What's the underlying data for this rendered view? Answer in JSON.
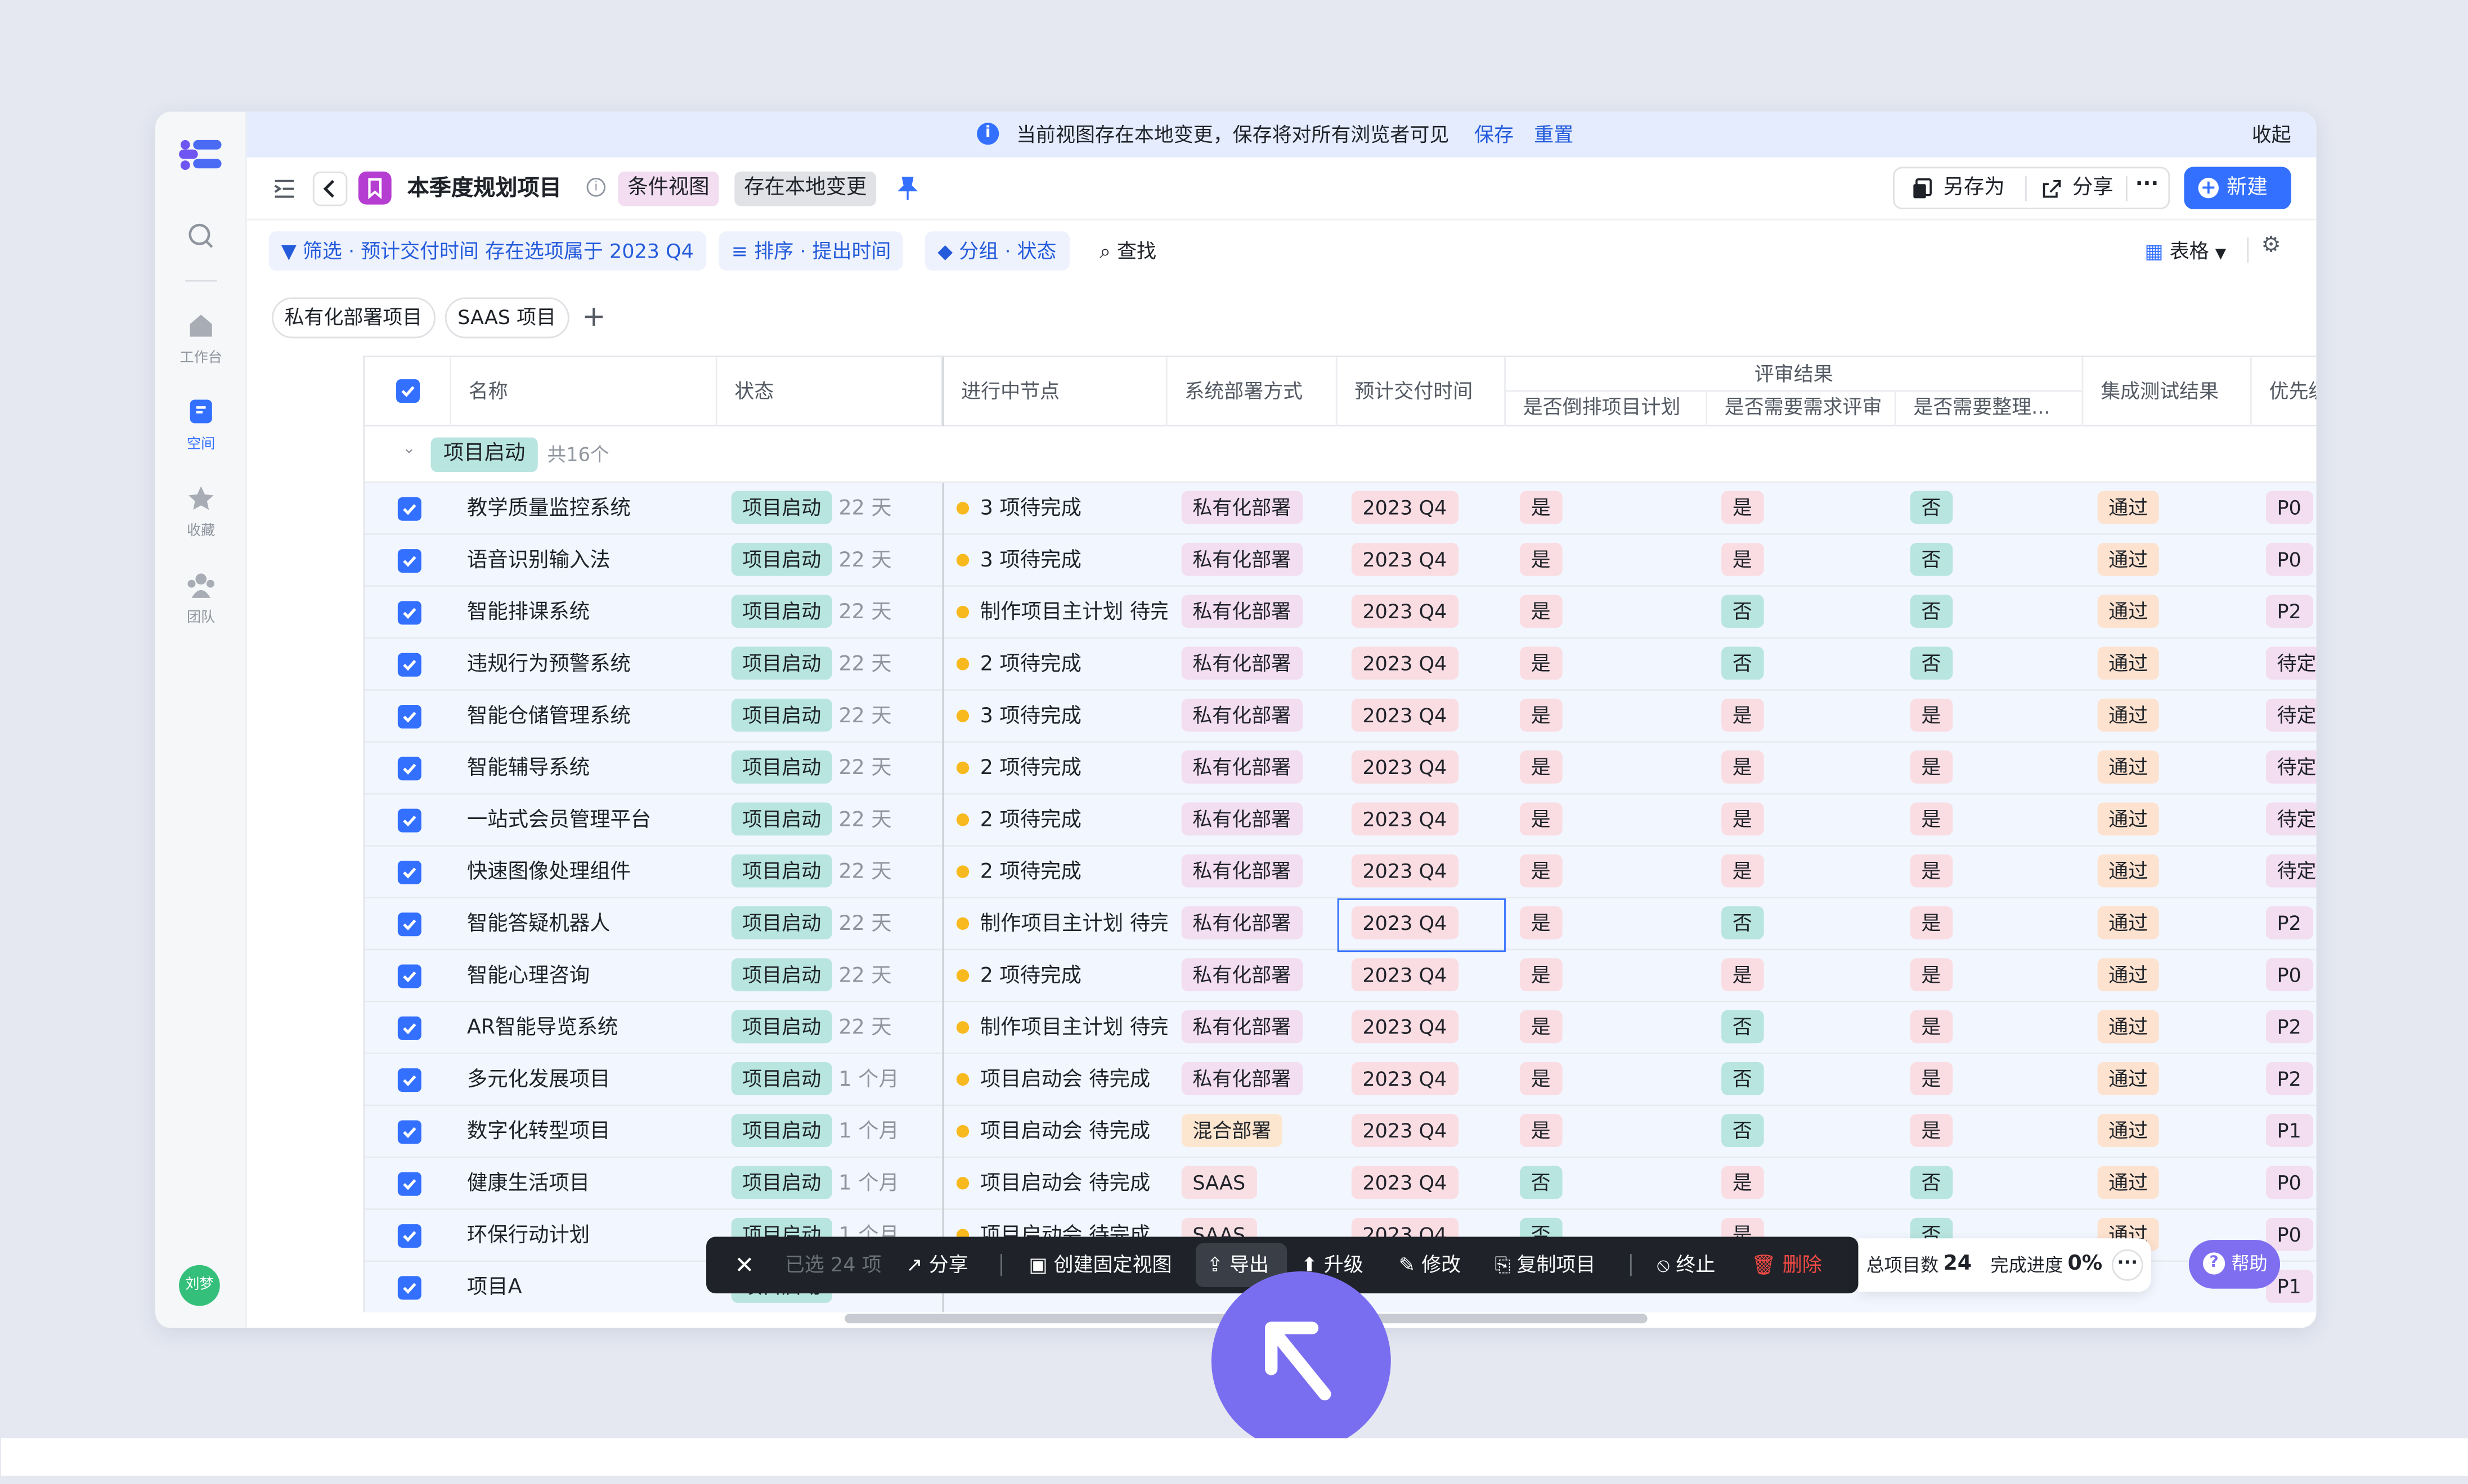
{
  "user": {
    "avatar_label": "刘梦"
  },
  "sidebar": {
    "items": [
      {
        "label": ""
      },
      {
        "label": "工作台"
      },
      {
        "label": "空间"
      },
      {
        "label": "收藏"
      },
      {
        "label": "团队"
      }
    ]
  },
  "banner": {
    "message": "当前视图存在本地变更，保存将对所有浏览者可见",
    "save": "保存",
    "reset": "重置",
    "collapse": "收起"
  },
  "header": {
    "title": "本季度规划项目",
    "view_type": "条件视图",
    "local_changes": "存在本地变更",
    "save_as": "另存为",
    "share": "分享",
    "new": "新建"
  },
  "filters": {
    "filter": "筛选 · 预计交付时间 存在选项属于 2023 Q4",
    "sort": "排序 · 提出时间",
    "group": "分组 · 状态",
    "search": "查找",
    "view_mode": "表格"
  },
  "tabs": [
    "私有化部署项目",
    "SAAS 项目"
  ],
  "columns": {
    "name": "名称",
    "status": "状态",
    "node": "进行中节点",
    "deploy": "系统部署方式",
    "delivery": "预计交付时间",
    "review_group": "评审结果",
    "review_1": "是否倒排项目计划",
    "review_2": "是否需要需求评审",
    "review_3": "是否需要整理...",
    "test": "集成测试结果",
    "priority": "优先级"
  },
  "group": {
    "label": "项目启动",
    "count": "共16个"
  },
  "rows": [
    {
      "name": "教学质量监控系统",
      "status": "项目启动",
      "duration": "22 天",
      "node": "3 项待完成",
      "deploy": "私有化部署",
      "delivery": "2023 Q4",
      "r1": "是",
      "r2": "是",
      "r3": "否",
      "test": "通过",
      "priority": "P0"
    },
    {
      "name": "语音识别输入法",
      "status": "项目启动",
      "duration": "22 天",
      "node": "3 项待完成",
      "deploy": "私有化部署",
      "delivery": "2023 Q4",
      "r1": "是",
      "r2": "是",
      "r3": "否",
      "test": "通过",
      "priority": "P0"
    },
    {
      "name": "智能排课系统",
      "status": "项目启动",
      "duration": "22 天",
      "node": "制作项目主计划 待完",
      "deploy": "私有化部署",
      "delivery": "2023 Q4",
      "r1": "是",
      "r2": "否",
      "r3": "否",
      "test": "通过",
      "priority": "P2"
    },
    {
      "name": "违规行为预警系统",
      "status": "项目启动",
      "duration": "22 天",
      "node": "2 项待完成",
      "deploy": "私有化部署",
      "delivery": "2023 Q4",
      "r1": "是",
      "r2": "否",
      "r3": "否",
      "test": "通过",
      "priority": "待定"
    },
    {
      "name": "智能仓储管理系统",
      "status": "项目启动",
      "duration": "22 天",
      "node": "3 项待完成",
      "deploy": "私有化部署",
      "delivery": "2023 Q4",
      "r1": "是",
      "r2": "是",
      "r3": "是",
      "test": "通过",
      "priority": "待定"
    },
    {
      "name": "智能辅导系统",
      "status": "项目启动",
      "duration": "22 天",
      "node": "2 项待完成",
      "deploy": "私有化部署",
      "delivery": "2023 Q4",
      "r1": "是",
      "r2": "是",
      "r3": "是",
      "test": "通过",
      "priority": "待定"
    },
    {
      "name": "一站式会员管理平台",
      "status": "项目启动",
      "duration": "22 天",
      "node": "2 项待完成",
      "deploy": "私有化部署",
      "delivery": "2023 Q4",
      "r1": "是",
      "r2": "是",
      "r3": "是",
      "test": "通过",
      "priority": "待定"
    },
    {
      "name": "快速图像处理组件",
      "status": "项目启动",
      "duration": "22 天",
      "node": "2 项待完成",
      "deploy": "私有化部署",
      "delivery": "2023 Q4",
      "r1": "是",
      "r2": "是",
      "r3": "是",
      "test": "通过",
      "priority": "待定"
    },
    {
      "name": "智能答疑机器人",
      "status": "项目启动",
      "duration": "22 天",
      "node": "制作项目主计划 待完",
      "deploy": "私有化部署",
      "delivery": "2023 Q4",
      "r1": "是",
      "r2": "否",
      "r3": "是",
      "test": "通过",
      "priority": "P2"
    },
    {
      "name": "智能心理咨询",
      "status": "项目启动",
      "duration": "22 天",
      "node": "2 项待完成",
      "deploy": "私有化部署",
      "delivery": "2023 Q4",
      "r1": "是",
      "r2": "是",
      "r3": "是",
      "test": "通过",
      "priority": "P0"
    },
    {
      "name": "AR智能导览系统",
      "status": "项目启动",
      "duration": "22 天",
      "node": "制作项目主计划 待完",
      "deploy": "私有化部署",
      "delivery": "2023 Q4",
      "r1": "是",
      "r2": "否",
      "r3": "是",
      "test": "通过",
      "priority": "P2"
    },
    {
      "name": "多元化发展项目",
      "status": "项目启动",
      "duration": "1 个月",
      "node": "项目启动会 待完成",
      "deploy": "私有化部署",
      "delivery": "2023 Q4",
      "r1": "是",
      "r2": "否",
      "r3": "是",
      "test": "通过",
      "priority": "P2"
    },
    {
      "name": "数字化转型项目",
      "status": "项目启动",
      "duration": "1 个月",
      "node": "项目启动会 待完成",
      "deploy": "混合部署",
      "delivery": "2023 Q4",
      "r1": "是",
      "r2": "否",
      "r3": "是",
      "test": "通过",
      "priority": "P1"
    },
    {
      "name": "健康生活项目",
      "status": "项目启动",
      "duration": "1 个月",
      "node": "项目启动会 待完成",
      "deploy": "SAAS",
      "delivery": "2023 Q4",
      "r1": "否",
      "r2": "是",
      "r3": "否",
      "test": "通过",
      "priority": "P0"
    },
    {
      "name": "环保行动计划",
      "status": "项目启动",
      "duration": "1 个月",
      "node": "项目启动会 待完成",
      "deploy": "SAAS",
      "delivery": "2023 Q4",
      "r1": "否",
      "r2": "是",
      "r3": "否",
      "test": "通过",
      "priority": "P0"
    },
    {
      "name": "项目A",
      "status": "项目启动",
      "duration": "",
      "node": "",
      "deploy": "",
      "delivery": "",
      "r1": "",
      "r2": "",
      "r3": "",
      "test": "",
      "priority": "P1"
    }
  ],
  "action_bar": {
    "selected": "已选 24 项",
    "share": "分享",
    "create_view": "创建固定视图",
    "export": "导出",
    "upgrade": "升级",
    "edit": "修改",
    "copy": "复制项目",
    "stop": "终止",
    "delete": "删除"
  },
  "stats": {
    "total_label": "总项目数",
    "total_value": "24",
    "progress_label": "完成进度",
    "progress_value": "0%"
  },
  "help": {
    "label": "帮助"
  },
  "colors": {
    "accent": "#3370ff",
    "cursor": "#7a6ef0",
    "banner_bg": "#e4ecfd"
  }
}
